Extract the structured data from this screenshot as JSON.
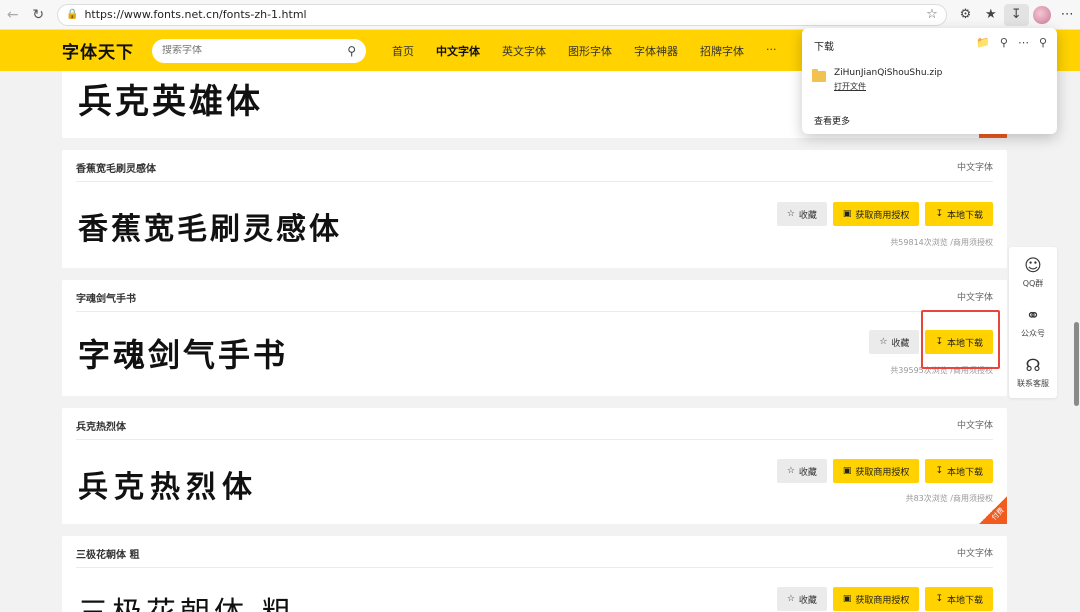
{
  "browser": {
    "url": "https://www.fonts.net.cn/fonts-zh-1.html"
  },
  "site": {
    "logo": "字体天下",
    "search_placeholder": "搜索字体",
    "nav": [
      {
        "label": "首页"
      },
      {
        "label": "中文字体"
      },
      {
        "label": "英文字体"
      },
      {
        "label": "图形字体"
      },
      {
        "label": "字体神器"
      },
      {
        "label": "招牌字体"
      },
      {
        "label": "···"
      }
    ]
  },
  "buttons": {
    "favorite": "收藏",
    "license": "获取商用授权",
    "download": "本地下载"
  },
  "cards": [
    {
      "preview": "兵克英雄体"
    },
    {
      "title": "香蕉宽毛刷灵感体",
      "category": "中文字体",
      "preview": "香蕉宽毛刷灵感体",
      "stats": "共59814次浏览 /商用须授权"
    },
    {
      "title": "字魂剑气手书",
      "category": "中文字体",
      "preview": "字魂剑气手书",
      "stats": "共39595次浏览 /商用须授权"
    },
    {
      "title": "兵克热烈体",
      "category": "中文字体",
      "preview": "兵克热烈体",
      "stats": "共83次浏览 /商用须授权",
      "badge": "付费"
    },
    {
      "title": "三极花朝体 粗",
      "category": "中文字体",
      "preview": "三极花朝体 粗"
    }
  ],
  "float_tools": [
    {
      "label": "QQ群",
      "icon": "qq-icon"
    },
    {
      "label": "公众号",
      "icon": "wechat-icon"
    },
    {
      "label": "联系客服",
      "icon": "headset-icon"
    }
  ],
  "download_popup": {
    "title": "下载",
    "file_name": "ZiHunJianQiShouShu.zip",
    "open_file": "打开文件",
    "see_more": "查看更多"
  }
}
